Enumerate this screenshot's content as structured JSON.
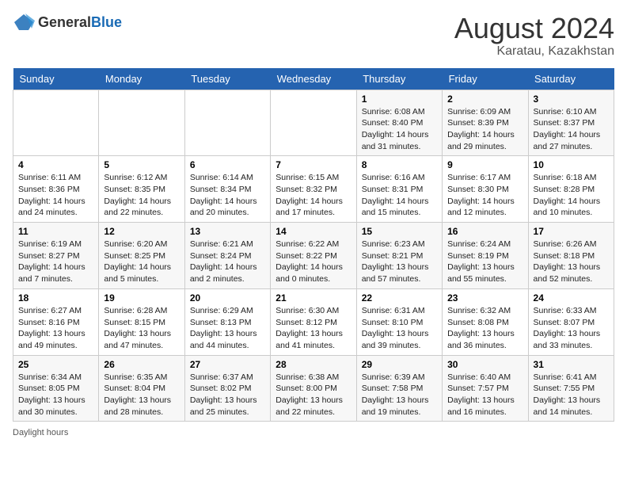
{
  "header": {
    "logo_general": "General",
    "logo_blue": "Blue",
    "month_year": "August 2024",
    "location": "Karatau, Kazakhstan"
  },
  "footer": {
    "daylight_label": "Daylight hours"
  },
  "days_of_week": [
    "Sunday",
    "Monday",
    "Tuesday",
    "Wednesday",
    "Thursday",
    "Friday",
    "Saturday"
  ],
  "weeks": [
    [
      {
        "day": "",
        "info": ""
      },
      {
        "day": "",
        "info": ""
      },
      {
        "day": "",
        "info": ""
      },
      {
        "day": "",
        "info": ""
      },
      {
        "day": "1",
        "info": "Sunrise: 6:08 AM\nSunset: 8:40 PM\nDaylight: 14 hours and 31 minutes."
      },
      {
        "day": "2",
        "info": "Sunrise: 6:09 AM\nSunset: 8:39 PM\nDaylight: 14 hours and 29 minutes."
      },
      {
        "day": "3",
        "info": "Sunrise: 6:10 AM\nSunset: 8:37 PM\nDaylight: 14 hours and 27 minutes."
      }
    ],
    [
      {
        "day": "4",
        "info": "Sunrise: 6:11 AM\nSunset: 8:36 PM\nDaylight: 14 hours and 24 minutes."
      },
      {
        "day": "5",
        "info": "Sunrise: 6:12 AM\nSunset: 8:35 PM\nDaylight: 14 hours and 22 minutes."
      },
      {
        "day": "6",
        "info": "Sunrise: 6:14 AM\nSunset: 8:34 PM\nDaylight: 14 hours and 20 minutes."
      },
      {
        "day": "7",
        "info": "Sunrise: 6:15 AM\nSunset: 8:32 PM\nDaylight: 14 hours and 17 minutes."
      },
      {
        "day": "8",
        "info": "Sunrise: 6:16 AM\nSunset: 8:31 PM\nDaylight: 14 hours and 15 minutes."
      },
      {
        "day": "9",
        "info": "Sunrise: 6:17 AM\nSunset: 8:30 PM\nDaylight: 14 hours and 12 minutes."
      },
      {
        "day": "10",
        "info": "Sunrise: 6:18 AM\nSunset: 8:28 PM\nDaylight: 14 hours and 10 minutes."
      }
    ],
    [
      {
        "day": "11",
        "info": "Sunrise: 6:19 AM\nSunset: 8:27 PM\nDaylight: 14 hours and 7 minutes."
      },
      {
        "day": "12",
        "info": "Sunrise: 6:20 AM\nSunset: 8:25 PM\nDaylight: 14 hours and 5 minutes."
      },
      {
        "day": "13",
        "info": "Sunrise: 6:21 AM\nSunset: 8:24 PM\nDaylight: 14 hours and 2 minutes."
      },
      {
        "day": "14",
        "info": "Sunrise: 6:22 AM\nSunset: 8:22 PM\nDaylight: 14 hours and 0 minutes."
      },
      {
        "day": "15",
        "info": "Sunrise: 6:23 AM\nSunset: 8:21 PM\nDaylight: 13 hours and 57 minutes."
      },
      {
        "day": "16",
        "info": "Sunrise: 6:24 AM\nSunset: 8:19 PM\nDaylight: 13 hours and 55 minutes."
      },
      {
        "day": "17",
        "info": "Sunrise: 6:26 AM\nSunset: 8:18 PM\nDaylight: 13 hours and 52 minutes."
      }
    ],
    [
      {
        "day": "18",
        "info": "Sunrise: 6:27 AM\nSunset: 8:16 PM\nDaylight: 13 hours and 49 minutes."
      },
      {
        "day": "19",
        "info": "Sunrise: 6:28 AM\nSunset: 8:15 PM\nDaylight: 13 hours and 47 minutes."
      },
      {
        "day": "20",
        "info": "Sunrise: 6:29 AM\nSunset: 8:13 PM\nDaylight: 13 hours and 44 minutes."
      },
      {
        "day": "21",
        "info": "Sunrise: 6:30 AM\nSunset: 8:12 PM\nDaylight: 13 hours and 41 minutes."
      },
      {
        "day": "22",
        "info": "Sunrise: 6:31 AM\nSunset: 8:10 PM\nDaylight: 13 hours and 39 minutes."
      },
      {
        "day": "23",
        "info": "Sunrise: 6:32 AM\nSunset: 8:08 PM\nDaylight: 13 hours and 36 minutes."
      },
      {
        "day": "24",
        "info": "Sunrise: 6:33 AM\nSunset: 8:07 PM\nDaylight: 13 hours and 33 minutes."
      }
    ],
    [
      {
        "day": "25",
        "info": "Sunrise: 6:34 AM\nSunset: 8:05 PM\nDaylight: 13 hours and 30 minutes."
      },
      {
        "day": "26",
        "info": "Sunrise: 6:35 AM\nSunset: 8:04 PM\nDaylight: 13 hours and 28 minutes."
      },
      {
        "day": "27",
        "info": "Sunrise: 6:37 AM\nSunset: 8:02 PM\nDaylight: 13 hours and 25 minutes."
      },
      {
        "day": "28",
        "info": "Sunrise: 6:38 AM\nSunset: 8:00 PM\nDaylight: 13 hours and 22 minutes."
      },
      {
        "day": "29",
        "info": "Sunrise: 6:39 AM\nSunset: 7:58 PM\nDaylight: 13 hours and 19 minutes."
      },
      {
        "day": "30",
        "info": "Sunrise: 6:40 AM\nSunset: 7:57 PM\nDaylight: 13 hours and 16 minutes."
      },
      {
        "day": "31",
        "info": "Sunrise: 6:41 AM\nSunset: 7:55 PM\nDaylight: 13 hours and 14 minutes."
      }
    ]
  ]
}
